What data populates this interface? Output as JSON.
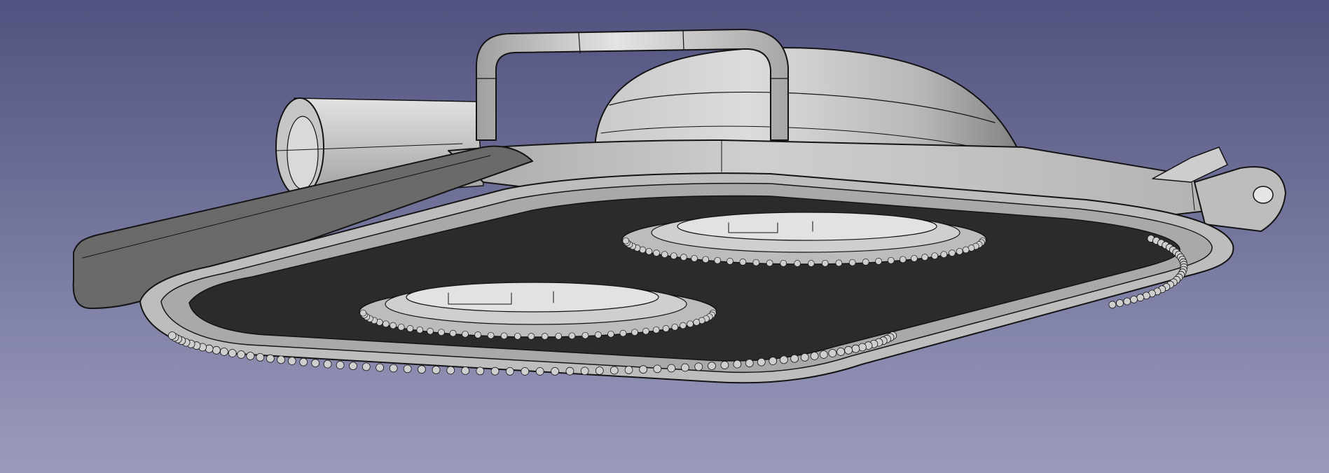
{
  "viewport": {
    "background": {
      "top_color": "#51527f",
      "bottom_color": "#9a9bbc"
    },
    "model": {
      "surface_light": "#d8d8d8",
      "surface_mid": "#b4b4b4",
      "surface_dark": "#6a6a6a",
      "cavity": "#2b2b2b",
      "edge": "#141414"
    }
  }
}
